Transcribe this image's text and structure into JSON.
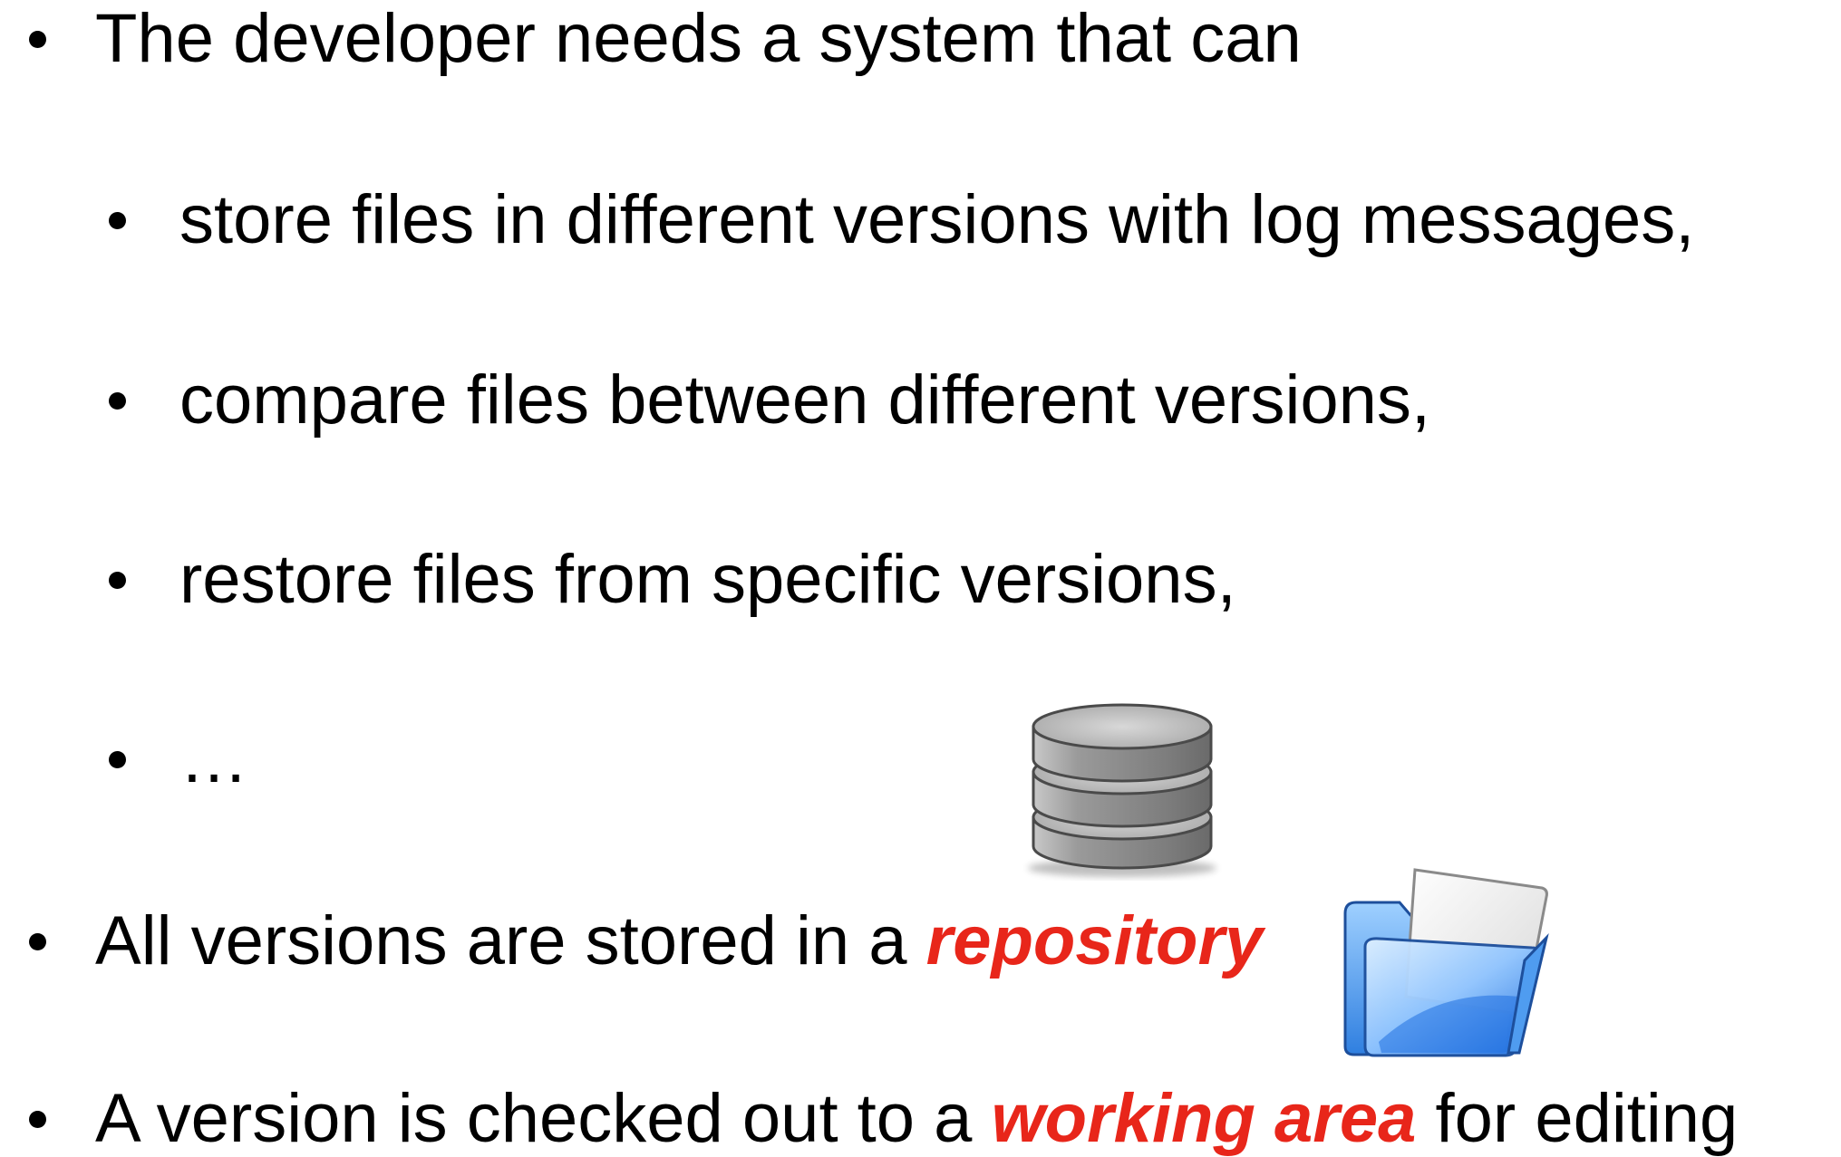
{
  "slide": {
    "intro": "The developer needs a system that can",
    "sub_items": [
      "store files in different versions with log messages,",
      "compare files between different versions,",
      "restore files from specific versions,",
      "…"
    ],
    "repo_line": {
      "before": "All versions are stored in a ",
      "emphasis": "repository"
    },
    "work_line": {
      "before": "A version is checked out to a ",
      "emphasis": "working area",
      "after": " for editing"
    }
  },
  "colors": {
    "text": "#000000",
    "emphasis": "#e8261a",
    "database": "#9a9a9a",
    "folder": "#3a8ee8"
  },
  "icons": [
    "database-icon",
    "folder-icon"
  ]
}
